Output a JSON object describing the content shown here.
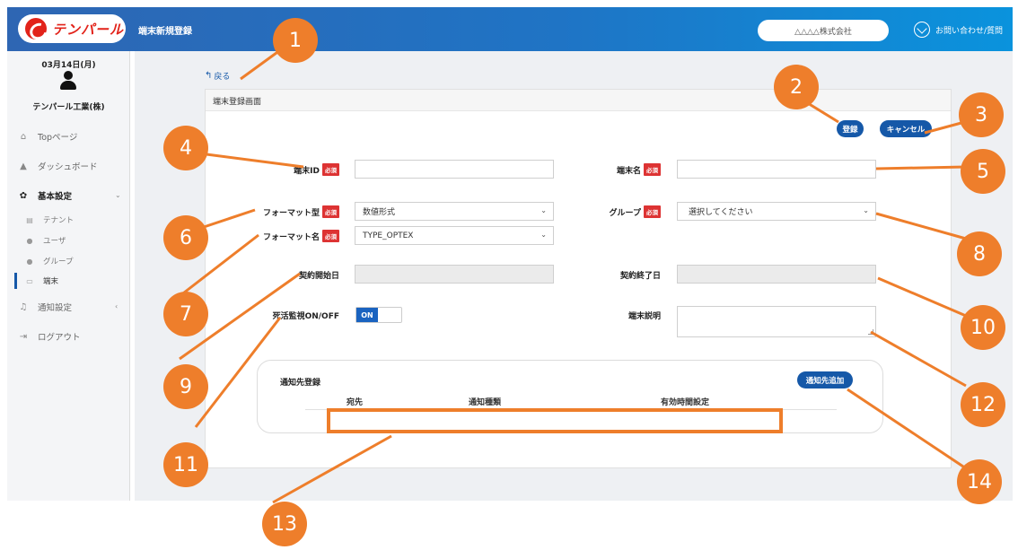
{
  "header": {
    "logo_text": "テンパール",
    "title": "端末新規登録",
    "company": "△△△△株式会社",
    "contact": "お問い合わせ/質問"
  },
  "sidebar": {
    "date": "03月14日(月)",
    "user": "テンパール工業(株)",
    "items": [
      {
        "label": "Topページ",
        "icon": "home-icon"
      },
      {
        "label": "ダッシュボード",
        "icon": "chart-icon"
      },
      {
        "label": "基本設定",
        "icon": "gear-icon"
      },
      {
        "label": "通知設定",
        "icon": "bell-icon"
      },
      {
        "label": "ログアウト",
        "icon": "logout-icon"
      }
    ],
    "sub_items": [
      {
        "label": "テナント",
        "icon": "building-icon"
      },
      {
        "label": "ユーザ",
        "icon": "user-icon"
      },
      {
        "label": "グループ",
        "icon": "group-icon"
      },
      {
        "label": "端末",
        "icon": "monitor-icon"
      }
    ]
  },
  "main": {
    "back": "戻る",
    "panel_title": "端末登録画面",
    "register_btn": "登録",
    "cancel_btn": "キャンセル",
    "required": "必須",
    "fields": {
      "terminal_id_label": "端末ID",
      "terminal_name_label": "端末名",
      "format_type_label": "フォーマット型",
      "format_type_value": "数値形式",
      "group_label": "グループ",
      "group_placeholder": "選択してください",
      "format_name_label": "フォーマット名",
      "format_name_value": "TYPE_OPTEX",
      "contract_start_label": "契約開始日",
      "contract_end_label": "契約終了日",
      "alive_monitor_label": "死活監視ON/OFF",
      "toggle_on": "ON",
      "terminal_desc_label": "端末説明"
    },
    "notify": {
      "title": "通知先登録",
      "add_btn": "通知先追加",
      "columns": [
        "宛先",
        "通知種類",
        "有効時間設定"
      ]
    }
  },
  "annotations": [
    "1",
    "2",
    "3",
    "4",
    "5",
    "6",
    "7",
    "8",
    "9",
    "10",
    "11",
    "12",
    "13",
    "14"
  ],
  "colors": {
    "accent": "#1558a8",
    "annotation": "#ee7e2b",
    "required": "#dd3333"
  }
}
